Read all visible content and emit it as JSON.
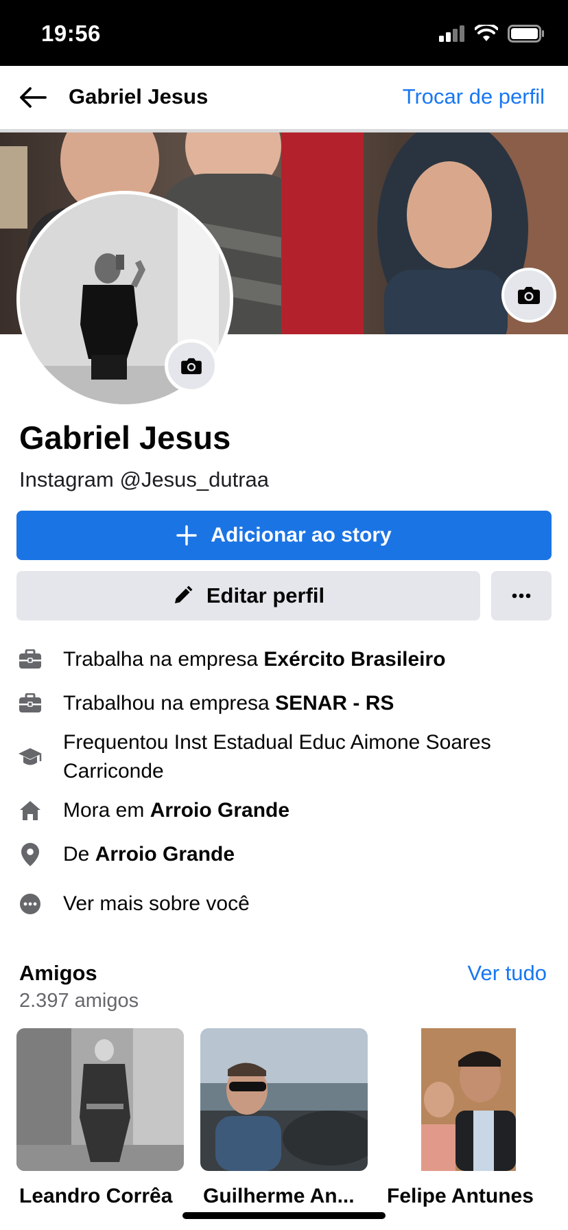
{
  "status_bar": {
    "time": "19:56",
    "icons": [
      "signal-icon",
      "wifi-icon",
      "battery-icon"
    ]
  },
  "nav": {
    "back_icon": "arrow-left-icon",
    "title": "Gabriel Jesus",
    "switch_profile": "Trocar de perfil"
  },
  "profile": {
    "name": "Gabriel Jesus",
    "bio": "Instagram @Jesus_dutraa",
    "add_story_label": "Adicionar ao story",
    "edit_profile_label": "Editar perfil"
  },
  "details": [
    {
      "icon": "briefcase-icon",
      "prefix": "Trabalha na empresa ",
      "bold": "Exército Brasileiro"
    },
    {
      "icon": "briefcase-icon",
      "prefix": "Trabalhou na empresa ",
      "bold": "SENAR - RS"
    },
    {
      "icon": "graduation-cap-icon",
      "prefix": "Frequentou Inst Estadual Educ Aimone Soares Carriconde",
      "bold": ""
    },
    {
      "icon": "home-icon",
      "prefix": "Mora em ",
      "bold": "Arroio Grande"
    },
    {
      "icon": "location-pin-icon",
      "prefix": "De ",
      "bold": "Arroio Grande"
    },
    {
      "icon": "more-dots-icon",
      "prefix": "Ver mais sobre você",
      "bold": ""
    }
  ],
  "friends": {
    "title": "Amigos",
    "count": "2.397 amigos",
    "see_all": "Ver tudo",
    "list": [
      {
        "name": "Leandro Corrêa"
      },
      {
        "name": "Guilherme An..."
      },
      {
        "name": "Felipe Antunes"
      }
    ]
  },
  "colors": {
    "accent": "#1877f2",
    "button_primary": "#1b74e4",
    "button_secondary": "#e4e6eb",
    "muted_text": "#65676b"
  }
}
